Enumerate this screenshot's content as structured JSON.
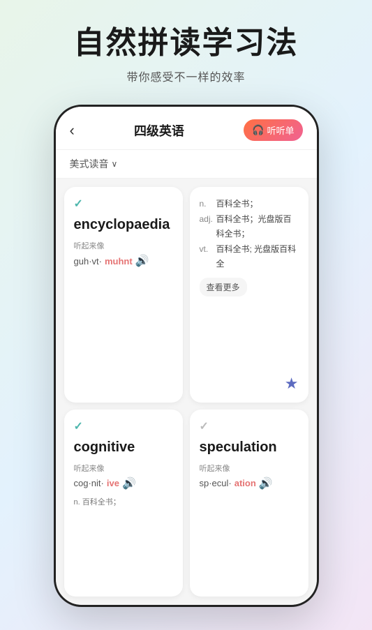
{
  "page": {
    "main_title": "自然拼读学习法",
    "sub_title": "带你感受不一样的效率"
  },
  "app": {
    "back_label": "‹",
    "page_title": "四级英语",
    "listen_label": "听听单",
    "pronunciation_label": "美式读音",
    "dropdown_arrow": "∨"
  },
  "cards": [
    {
      "id": "encyclopaedia",
      "checked": true,
      "checked_color": "teal",
      "word": "encyclopaedia",
      "phonetic_label": "听起来像",
      "phonetic_before": "guh·vt·",
      "phonetic_stress": "muhnt",
      "has_sound": true,
      "definitions": [
        {
          "tag": "n.",
          "text": "百科全书；"
        },
        {
          "tag": "adj.",
          "text": "百科全书；光盘版百科全书；"
        },
        {
          "tag": "vt.",
          "text": "百科全书; 光盘版百科全"
        }
      ],
      "see_more": "查看更多",
      "has_star": true
    },
    {
      "id": "cognitive",
      "checked": true,
      "checked_color": "teal",
      "word": "cognitive",
      "phonetic_label": "听起来像",
      "phonetic_before": "cog·nit·",
      "phonetic_stress": "ive",
      "has_sound": true,
      "bottom_def": "n. 百科全书；"
    },
    {
      "id": "speculation",
      "checked": true,
      "checked_color": "gray",
      "word": "speculation",
      "phonetic_label": "听起来像",
      "phonetic_before": "sp·ecul·",
      "phonetic_stress": "ation",
      "has_sound": true
    }
  ]
}
